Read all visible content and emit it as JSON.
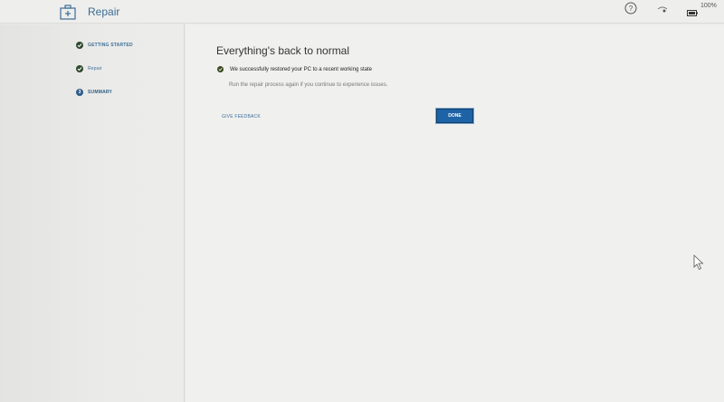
{
  "header": {
    "app_title": "Repair",
    "app_icon": "toolbox-icon",
    "battery": "100%"
  },
  "sidebar": {
    "steps": [
      {
        "label": "GETTING STARTED",
        "state": "complete"
      },
      {
        "label": "Repair",
        "state": "complete"
      },
      {
        "label": "SUMMARY",
        "state": "current",
        "number": "3"
      }
    ]
  },
  "main": {
    "heading": "Everything's back to normal",
    "success_message": "We successfully restored your PC to a recent working state",
    "subtext": "Run the repair process again if you continue to experience issues.",
    "feedback_link": "GIVE FEEDBACK",
    "done_button": "DONE"
  },
  "colors": {
    "accent": "#1e63a6",
    "link": "#3d6f9b",
    "background": "#f0f0ee",
    "check": "#2f4a2f"
  }
}
